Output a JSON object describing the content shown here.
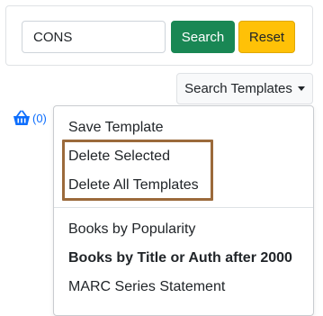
{
  "search": {
    "value": "CONS",
    "search_label": "Search",
    "reset_label": "Reset"
  },
  "templates": {
    "toggle_label": "Search Templates",
    "menu": {
      "save": "Save Template",
      "delete_selected": "Delete Selected",
      "delete_all": "Delete All Templates",
      "saved": [
        "Books by Popularity",
        "Books by Title or Auth after 2000",
        "MARC Series Statement"
      ]
    }
  },
  "basket": {
    "icon": "basket-icon",
    "count": "(0)"
  },
  "colors": {
    "primary_green": "#198754",
    "reset_yellow": "#ffc107",
    "link_blue": "#0d6efd",
    "highlight_brown": "#9b6a3b"
  }
}
